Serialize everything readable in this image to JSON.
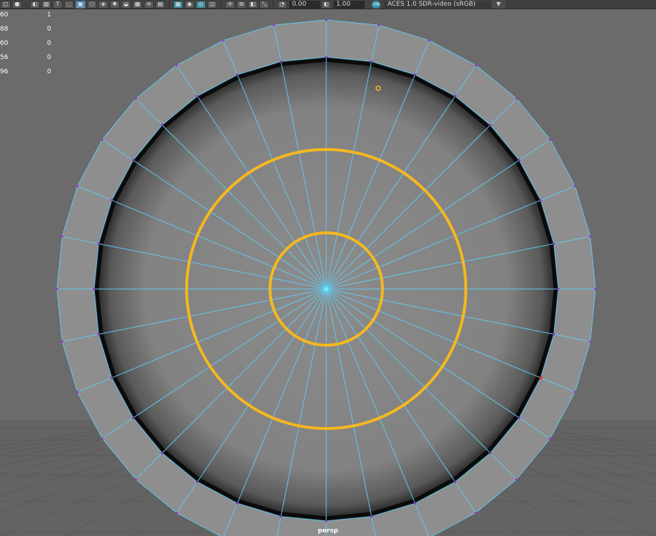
{
  "toolbar": {
    "exposure_value": "0.00",
    "gamma_value": "1.00",
    "view_transform_badge": "ON",
    "color_space": "ACES 1.0 SDR-video (sRGB)",
    "dropdown_glyph": "▼",
    "icons": [
      "wireframe-icon",
      "smooth-shade-icon",
      "shaded-icon",
      "textured-icon",
      "text-icon",
      "cube-icon",
      "isolate-icon",
      "xray-icon",
      "backface-icon",
      "light-icon",
      "shadow-icon",
      "ao-icon",
      "motion-blur-icon",
      "aa-icon",
      "grid-icon",
      "camera-icon",
      "select-icon",
      "snap-icon",
      "pivot-icon",
      "frame-icon",
      "exposure-icon",
      "gamma-icon"
    ]
  },
  "hud": {
    "rows": [
      {
        "a": "60",
        "b": "1"
      },
      {
        "a": "88",
        "b": "0"
      },
      {
        "a": "60",
        "b": "0"
      },
      {
        "a": "56",
        "b": "0"
      },
      {
        "a": "96",
        "b": "0"
      }
    ]
  },
  "viewport": {
    "camera_label": "persp",
    "mesh": {
      "radial_segments": 32,
      "colors": {
        "background": "#6b6b6b",
        "floor_grid": "#5a5a5a",
        "edge": "#5fc9f0",
        "outer_face": "#8e8e8e",
        "inner_face": "#7a7a7a",
        "groove": "#0a0a0a",
        "vertex": "#9b2fd0",
        "selected_vertex": "#ff2020",
        "manipulator": "#f5b820",
        "center_point": "#7fe6ff"
      }
    }
  }
}
